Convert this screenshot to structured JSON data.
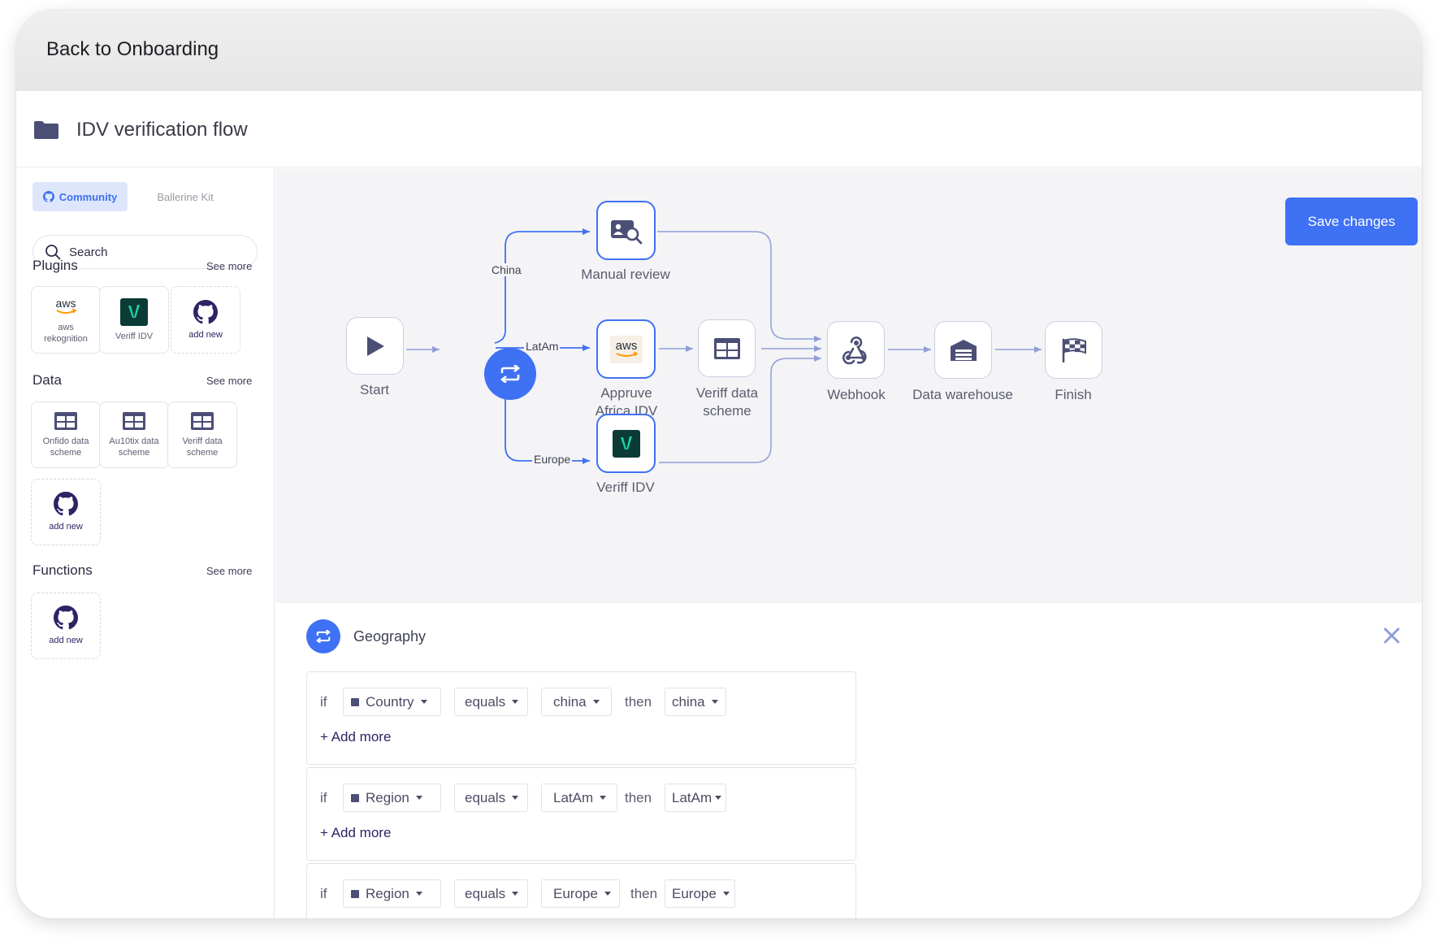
{
  "header": {
    "back_label": "Back to Onboarding",
    "flow_title": "IDV verification flow"
  },
  "sidebar": {
    "tabs": [
      {
        "label": "Community",
        "active": true
      },
      {
        "label": "Ballerine Kit",
        "active": false
      }
    ],
    "search_placeholder": "Search",
    "see_more": "See more",
    "sections": {
      "plugins": {
        "title": "Plugins",
        "items": [
          {
            "label": "aws rekognition",
            "icon": "aws-icon"
          },
          {
            "label": "Veriff IDV",
            "icon": "veriff-icon"
          },
          {
            "label": "add new",
            "icon": "github-icon"
          }
        ]
      },
      "data": {
        "title": "Data",
        "items": [
          {
            "label": "Onfido data scheme",
            "icon": "table-icon"
          },
          {
            "label": "Au10tix data scheme",
            "icon": "table-icon"
          },
          {
            "label": "Veriff data scheme",
            "icon": "table-icon"
          },
          {
            "label": "add new",
            "icon": "github-icon"
          }
        ]
      },
      "functions": {
        "title": "Functions",
        "items": [
          {
            "label": "add new",
            "icon": "github-icon"
          }
        ]
      }
    }
  },
  "canvas": {
    "save_label": "Save changes",
    "nodes": {
      "start": "Start",
      "manual_review": "Manual review",
      "appruve": "Appruve Africa IDV",
      "veriff_scheme": "Veriff data scheme",
      "veriff_idv": "Veriff IDV",
      "webhook": "Webhook",
      "warehouse": "Data warehouse",
      "finish": "Finish"
    },
    "edge_labels": {
      "china": "China",
      "latam": "LatAm",
      "europe": "Europe"
    },
    "aws_text": "aws"
  },
  "panel": {
    "title": "Geography",
    "if_label": "if",
    "then_label": "then",
    "add_more_label": "+ Add more",
    "rules": [
      {
        "field": "Country",
        "operator": "equals",
        "value": "china",
        "target": "china"
      },
      {
        "field": "Region",
        "operator": "equals",
        "value": "LatAm",
        "target": "LatAm"
      },
      {
        "field": "Region",
        "operator": "equals",
        "value": "Europe",
        "target": "Europe"
      }
    ]
  },
  "colors": {
    "accent": "#3f71f4",
    "icon_dark": "#4c4f75",
    "canvas_bg": "#f4f4f6",
    "connector": "#8f9ed8"
  }
}
